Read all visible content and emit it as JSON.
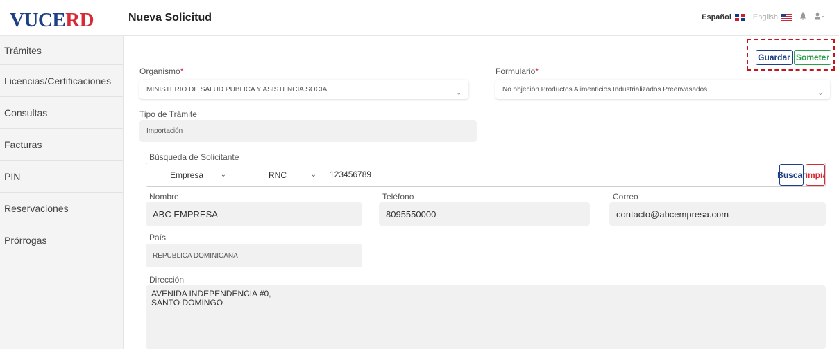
{
  "app": {
    "logo_part1": "VU",
    "logo_part2": "CE",
    "logo_part3": "RD",
    "page_title": "Nueva Solicitud"
  },
  "header": {
    "lang_es": "Español",
    "lang_en": "English"
  },
  "sidebar": {
    "items": [
      {
        "label": "Trámites"
      },
      {
        "label": "Licencias/Certificaciones"
      },
      {
        "label": "Consultas"
      },
      {
        "label": "Facturas"
      },
      {
        "label": "PIN"
      },
      {
        "label": "Reservaciones"
      },
      {
        "label": "Prórrogas"
      }
    ]
  },
  "actions": {
    "guardar": "Guardar",
    "someter": "Someter"
  },
  "form": {
    "organismo_label": "Organismo",
    "organismo_value": "MINISTERIO DE SALUD PUBLICA Y ASISTENCIA SOCIAL",
    "formulario_label": "Formulario",
    "formulario_value": "No objeción Productos Alimenticios Industrializados Preenvasados",
    "tipo_label": "Tipo de Trámite",
    "tipo_value": "Importación",
    "busqueda_label": "Búsqueda de Solicitante",
    "tipo_solicitante": "Empresa",
    "tipo_documento": "RNC",
    "documento_value": "123456789",
    "buscar": "Buscar",
    "limpiar": "Limpiar",
    "nombre_label": "Nombre",
    "nombre_value": "ABC EMPRESA",
    "telefono_label": "Teléfono",
    "telefono_value": "8095550000",
    "correo_label": "Correo",
    "correo_value": "contacto@abcempresa.com",
    "pais_label": "País",
    "pais_value": "REPUBLICA DOMINICANA",
    "direccion_label": "Dirección",
    "direccion_line1": "AVENIDA INDEPENDENCIA #0,",
    "direccion_line2": "SANTO DOMINGO"
  },
  "colors": {
    "brand_navy": "#1c3f86",
    "brand_red": "#d62b34",
    "submit_green": "#2aa04a",
    "highlight_red": "#c8131d"
  }
}
